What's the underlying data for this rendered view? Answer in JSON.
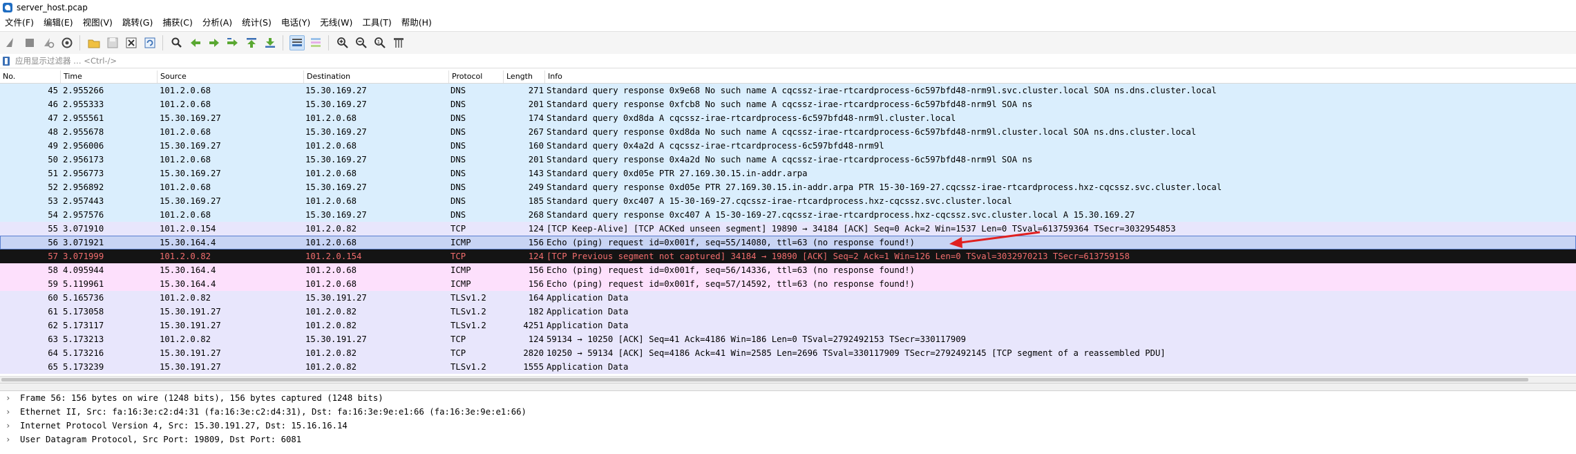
{
  "window": {
    "title": "server_host.pcap"
  },
  "menu": [
    "文件(F)",
    "编辑(E)",
    "视图(V)",
    "跳转(G)",
    "捕获(C)",
    "分析(A)",
    "统计(S)",
    "电话(Y)",
    "无线(W)",
    "工具(T)",
    "帮助(H)"
  ],
  "toolbar": {
    "icons": [
      "shark-fin-start-icon",
      "stop-icon",
      "restart-icon",
      "capture-options-icon",
      "open-folder-icon",
      "save-icon",
      "close-file-icon",
      "reload-icon",
      "find-icon",
      "go-back-icon",
      "go-forward-icon",
      "go-to-packet-icon",
      "first-packet-icon",
      "last-packet-icon",
      "autoscroll-icon",
      "colorize-icon",
      "zoom-in-icon",
      "zoom-out-icon",
      "normal-size-icon",
      "resize-columns-icon"
    ],
    "active": [
      "autoscroll-icon"
    ]
  },
  "filter": {
    "placeholder": "应用显示过滤器 … <Ctrl-/>",
    "value": ""
  },
  "columns": {
    "no": "No.",
    "time": "Time",
    "source": "Source",
    "destination": "Destination",
    "protocol": "Protocol",
    "length": "Length",
    "info": "Info"
  },
  "colors": {
    "dns": "#daeefd",
    "tcp": "#e8e6fc",
    "icmp": "#fde0fc",
    "selected": "#c8d4f4",
    "error_bg": "#141414",
    "error_fg": "#f26d6d",
    "arrow": "#e02020"
  },
  "packets": [
    {
      "no": "45",
      "time": "2.955266",
      "src": "101.2.0.68",
      "dst": "15.30.169.27",
      "proto": "DNS",
      "len": "271",
      "info": "Standard query response 0x9e68 No such name A cqcssz-irae-rtcardprocess-6c597bfd48-nrm9l.svc.cluster.local SOA ns.dns.cluster.local",
      "kind": "dns"
    },
    {
      "no": "46",
      "time": "2.955333",
      "src": "101.2.0.68",
      "dst": "15.30.169.27",
      "proto": "DNS",
      "len": "201",
      "info": "Standard query response 0xfcb8 No such name A cqcssz-irae-rtcardprocess-6c597bfd48-nrm9l SOA ns",
      "kind": "dns"
    },
    {
      "no": "47",
      "time": "2.955561",
      "src": "15.30.169.27",
      "dst": "101.2.0.68",
      "proto": "DNS",
      "len": "174",
      "info": "Standard query 0xd8da A cqcssz-irae-rtcardprocess-6c597bfd48-nrm9l.cluster.local",
      "kind": "dns"
    },
    {
      "no": "48",
      "time": "2.955678",
      "src": "101.2.0.68",
      "dst": "15.30.169.27",
      "proto": "DNS",
      "len": "267",
      "info": "Standard query response 0xd8da No such name A cqcssz-irae-rtcardprocess-6c597bfd48-nrm9l.cluster.local SOA ns.dns.cluster.local",
      "kind": "dns"
    },
    {
      "no": "49",
      "time": "2.956006",
      "src": "15.30.169.27",
      "dst": "101.2.0.68",
      "proto": "DNS",
      "len": "160",
      "info": "Standard query 0x4a2d A cqcssz-irae-rtcardprocess-6c597bfd48-nrm9l",
      "kind": "dns"
    },
    {
      "no": "50",
      "time": "2.956173",
      "src": "101.2.0.68",
      "dst": "15.30.169.27",
      "proto": "DNS",
      "len": "201",
      "info": "Standard query response 0x4a2d No such name A cqcssz-irae-rtcardprocess-6c597bfd48-nrm9l SOA ns",
      "kind": "dns"
    },
    {
      "no": "51",
      "time": "2.956773",
      "src": "15.30.169.27",
      "dst": "101.2.0.68",
      "proto": "DNS",
      "len": "143",
      "info": "Standard query 0xd05e PTR 27.169.30.15.in-addr.arpa",
      "kind": "dns"
    },
    {
      "no": "52",
      "time": "2.956892",
      "src": "101.2.0.68",
      "dst": "15.30.169.27",
      "proto": "DNS",
      "len": "249",
      "info": "Standard query response 0xd05e PTR 27.169.30.15.in-addr.arpa PTR 15-30-169-27.cqcssz-irae-rtcardprocess.hxz-cqcssz.svc.cluster.local",
      "kind": "dns"
    },
    {
      "no": "53",
      "time": "2.957443",
      "src": "15.30.169.27",
      "dst": "101.2.0.68",
      "proto": "DNS",
      "len": "185",
      "info": "Standard query 0xc407 A 15-30-169-27.cqcssz-irae-rtcardprocess.hxz-cqcssz.svc.cluster.local",
      "kind": "dns"
    },
    {
      "no": "54",
      "time": "2.957576",
      "src": "101.2.0.68",
      "dst": "15.30.169.27",
      "proto": "DNS",
      "len": "268",
      "info": "Standard query response 0xc407 A 15-30-169-27.cqcssz-irae-rtcardprocess.hxz-cqcssz.svc.cluster.local A 15.30.169.27",
      "kind": "dns"
    },
    {
      "no": "55",
      "time": "3.071910",
      "src": "101.2.0.154",
      "dst": "101.2.0.82",
      "proto": "TCP",
      "len": "124",
      "info": "[TCP Keep-Alive] [TCP ACKed unseen segment] 19890 → 34184 [ACK] Seq=0 Ack=2 Win=1537 Len=0 TSval=613759364 TSecr=3032954853",
      "kind": "tcp"
    },
    {
      "no": "56",
      "time": "3.071921",
      "src": "15.30.164.4",
      "dst": "101.2.0.68",
      "proto": "ICMP",
      "len": "156",
      "info": "Echo (ping) request  id=0x001f, seq=55/14080, ttl=63 (no response found!)",
      "kind": "selected"
    },
    {
      "no": "57",
      "time": "3.071999",
      "src": "101.2.0.82",
      "dst": "101.2.0.154",
      "proto": "TCP",
      "len": "124",
      "info": "[TCP Previous segment not captured] 34184 → 19890 [ACK] Seq=2 Ack=1 Win=126 Len=0 TSval=3032970213 TSecr=613759158",
      "kind": "bad"
    },
    {
      "no": "58",
      "time": "4.095944",
      "src": "15.30.164.4",
      "dst": "101.2.0.68",
      "proto": "ICMP",
      "len": "156",
      "info": "Echo (ping) request  id=0x001f, seq=56/14336, ttl=63 (no response found!)",
      "kind": "icmp"
    },
    {
      "no": "59",
      "time": "5.119961",
      "src": "15.30.164.4",
      "dst": "101.2.0.68",
      "proto": "ICMP",
      "len": "156",
      "info": "Echo (ping) request  id=0x001f, seq=57/14592, ttl=63 (no response found!)",
      "kind": "icmp"
    },
    {
      "no": "60",
      "time": "5.165736",
      "src": "101.2.0.82",
      "dst": "15.30.191.27",
      "proto": "TLSv1.2",
      "len": "164",
      "info": "Application Data",
      "kind": "tls"
    },
    {
      "no": "61",
      "time": "5.173058",
      "src": "15.30.191.27",
      "dst": "101.2.0.82",
      "proto": "TLSv1.2",
      "len": "182",
      "info": "Application Data",
      "kind": "tls"
    },
    {
      "no": "62",
      "time": "5.173117",
      "src": "15.30.191.27",
      "dst": "101.2.0.82",
      "proto": "TLSv1.2",
      "len": "4251",
      "info": "Application Data",
      "kind": "tls"
    },
    {
      "no": "63",
      "time": "5.173213",
      "src": "101.2.0.82",
      "dst": "15.30.191.27",
      "proto": "TCP",
      "len": "124",
      "info": "59134 → 10250 [ACK] Seq=41 Ack=4186 Win=186 Len=0 TSval=2792492153 TSecr=330117909",
      "kind": "tcp"
    },
    {
      "no": "64",
      "time": "5.173216",
      "src": "15.30.191.27",
      "dst": "101.2.0.82",
      "proto": "TCP",
      "len": "2820",
      "info": "10250 → 59134 [ACK] Seq=4186 Ack=41 Win=2585 Len=2696 TSval=330117909 TSecr=2792492145 [TCP segment of a reassembled PDU]",
      "kind": "tcp"
    },
    {
      "no": "65",
      "time": "5.173239",
      "src": "15.30.191.27",
      "dst": "101.2.0.82",
      "proto": "TLSv1.2",
      "len": "1555",
      "info": "Application Data",
      "kind": "tls"
    }
  ],
  "details": [
    {
      "chevron": "›",
      "text": "Frame 56: 156 bytes on wire (1248 bits), 156 bytes captured (1248 bits)"
    },
    {
      "chevron": "›",
      "text": "Ethernet II, Src: fa:16:3e:c2:d4:31 (fa:16:3e:c2:d4:31), Dst: fa:16:3e:9e:e1:66 (fa:16:3e:9e:e1:66)"
    },
    {
      "chevron": "›",
      "text": "Internet Protocol Version 4, Src: 15.30.191.27, Dst: 15.16.16.14"
    },
    {
      "chevron": "›",
      "text": "User Datagram Protocol, Src Port: 19809, Dst Port: 6081"
    }
  ]
}
